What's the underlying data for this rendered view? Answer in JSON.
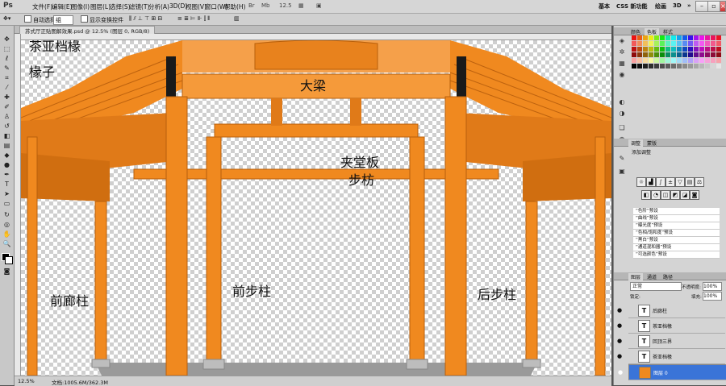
{
  "menubar": {
    "logo": "Ps",
    "menus": [
      "文件(F)",
      "编辑(E)",
      "图像(I)",
      "图层(L)",
      "选择(S)",
      "滤镜(T)",
      "分析(A)",
      "3D(D)",
      "视图(V)",
      "窗口(W)",
      "帮助(H)"
    ],
    "zoom": "12.5",
    "workspaces": [
      "基本",
      "CSS 新功能",
      "绘画",
      "3D"
    ],
    "more": "»"
  },
  "options": {
    "auto_select_label": "自动选择:",
    "auto_select_value": "组",
    "show_transform_label": "显示变换控件"
  },
  "document": {
    "tab_title": "苏式厅正贴图解效果.psd @ 12.5% (图层 0, RGB/8)",
    "zoom": "12.5%",
    "doc_size": "文档:1005.6M/362.3M"
  },
  "canvas_labels": {
    "cha": "茶亚档椽",
    "chuanzi": "椽子",
    "daliang": "大梁",
    "jiatangban": "夹堂板",
    "bufang": "步枋",
    "qianlangzhu": "前廊柱",
    "qianbuzhu": "前步柱",
    "houbuzhu": "后步柱"
  },
  "panels": {
    "color_tabs": [
      "颜色",
      "色板",
      "样式"
    ],
    "adjust_tabs": [
      "调整",
      "蒙版"
    ],
    "adjust_title": "添加调整",
    "presets": [
      "“色阶”预设",
      "“曲线”预设",
      "“曝光度”预设",
      "“色相/饱和度”预设",
      "“黑白”预设",
      "“通道混和器”预设",
      "“可选颜色”预设"
    ],
    "layers_tabs": [
      "图层",
      "通道",
      "路径"
    ],
    "blend_mode": "正常",
    "opacity_label": "不透明度:",
    "opacity_value": "100%",
    "lock_label": "锁定:",
    "fill_label": "填充:",
    "fill_value": "100%",
    "layers": [
      {
        "name": "后廊柱",
        "type": "T"
      },
      {
        "name": "茶亚档椽",
        "type": "T"
      },
      {
        "name": "回顶三界",
        "type": "T"
      },
      {
        "name": "茶亚档椽",
        "type": "T"
      },
      {
        "name": "图层 0",
        "type": "img"
      }
    ]
  },
  "colors": {
    "wood": "#f0891f",
    "wood_dark": "#c8640e",
    "selected_layer": "#3a74d8"
  }
}
